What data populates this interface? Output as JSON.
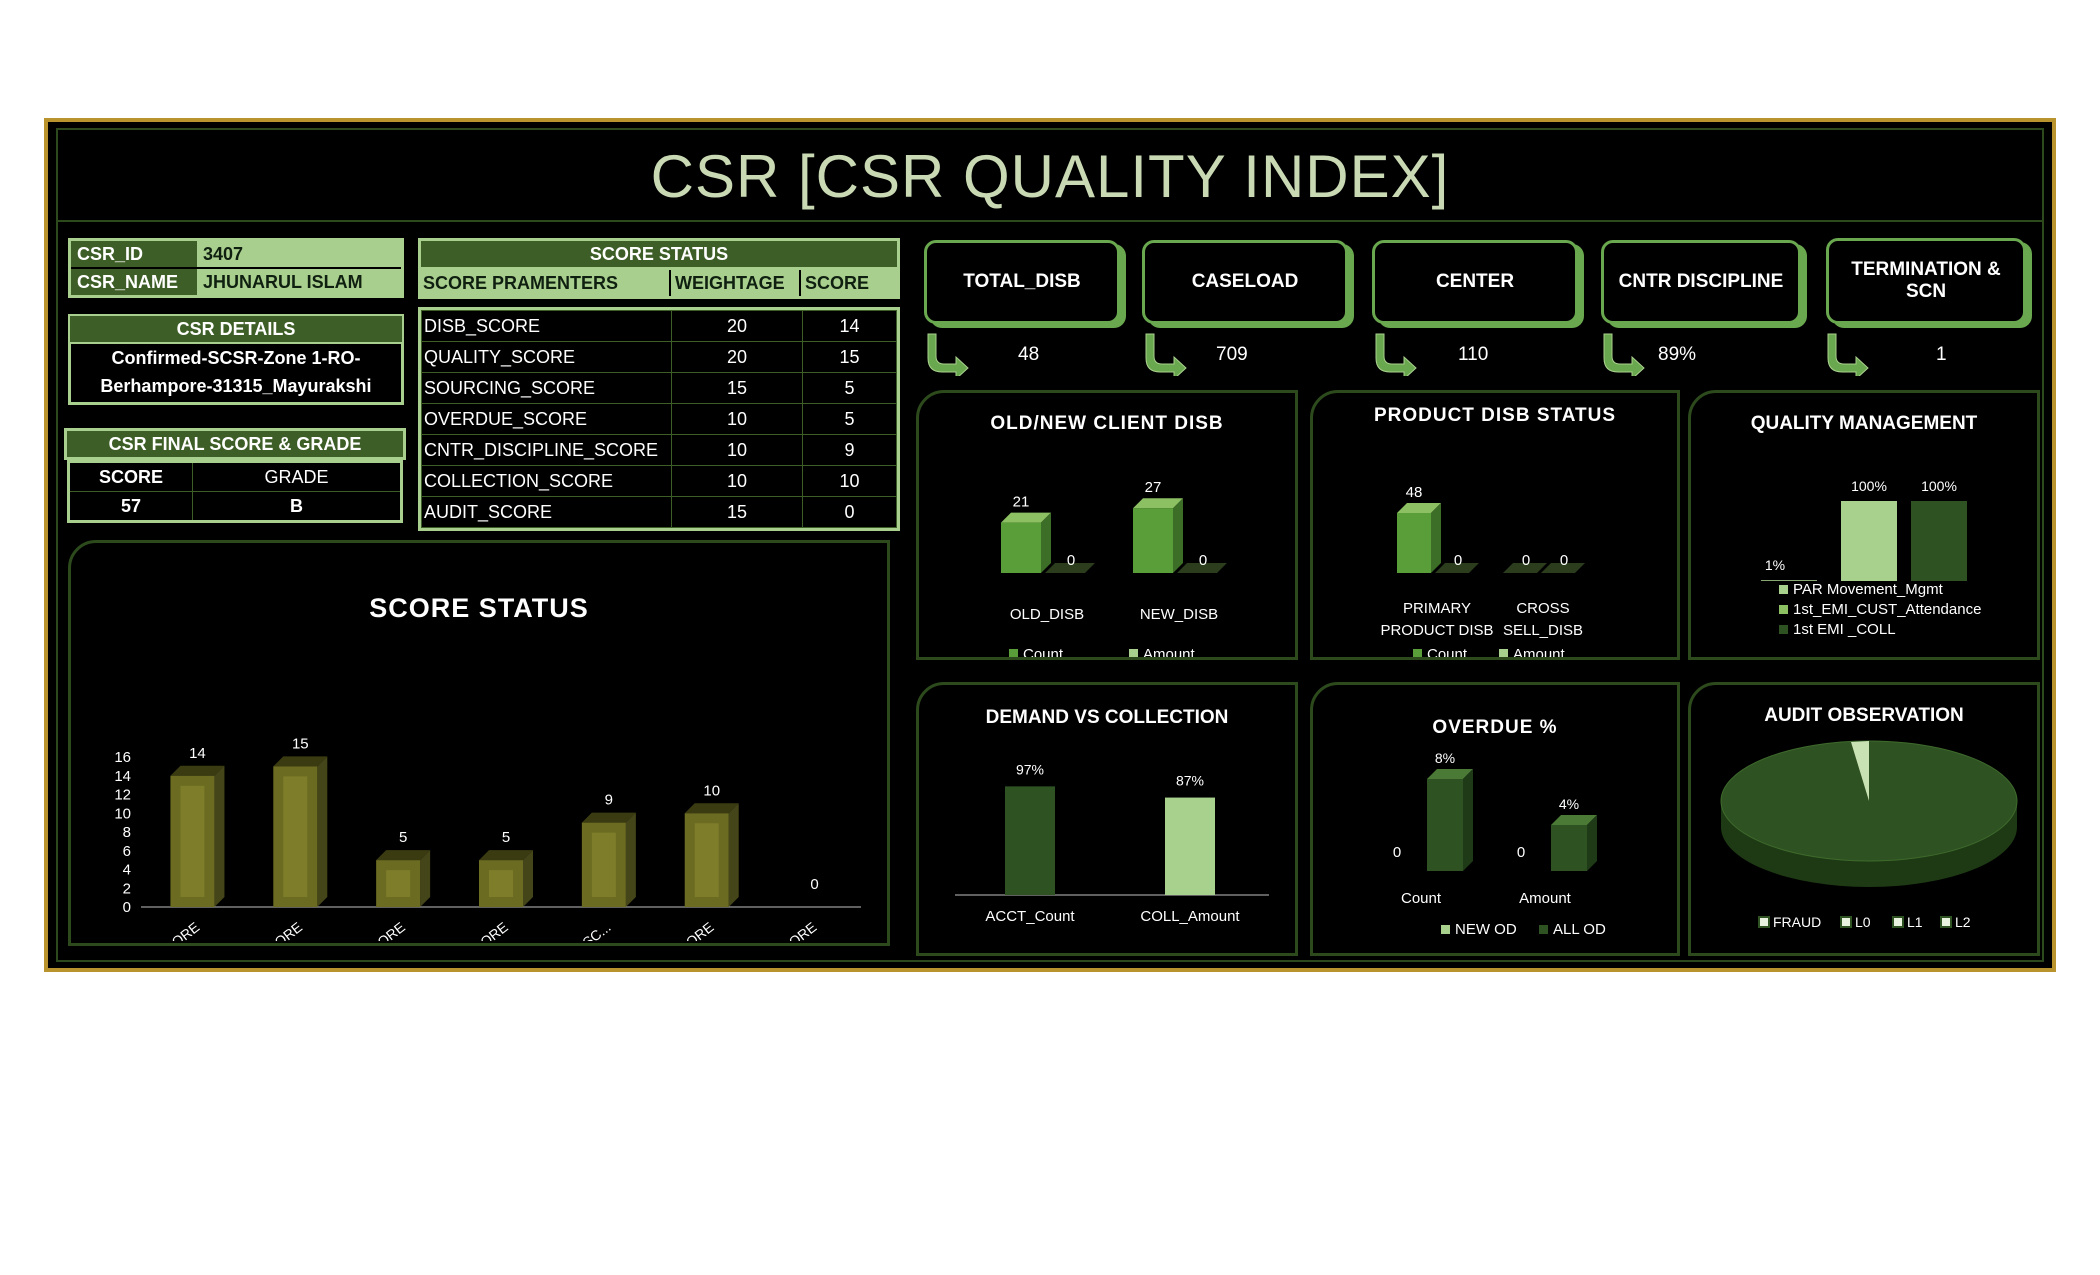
{
  "title": "CSR [CSR QUALITY INDEX]",
  "csr": {
    "id_label": "CSR_ID",
    "id_value": "3407",
    "name_label": "CSR_NAME",
    "name_value": "JHUNARUL ISLAM"
  },
  "details": {
    "header": "CSR DETAILS",
    "line1": "Confirmed-SCSR-Zone 1-RO-",
    "line2": "Berhampore-31315_Mayurakshi"
  },
  "final": {
    "header": "CSR FINAL SCORE & GRADE",
    "score_label": "SCORE",
    "grade_label": "GRADE",
    "score": "57",
    "grade": "B"
  },
  "score_status": {
    "header": "SCORE STATUS",
    "col1": "SCORE PRAMENTERS",
    "col2": "WEIGHTAGE",
    "col3": "SCORE",
    "rows": [
      {
        "name": "DISB_SCORE",
        "w": "20",
        "s": "14"
      },
      {
        "name": "QUALITY_SCORE",
        "w": "20",
        "s": "15"
      },
      {
        "name": "SOURCING_SCORE",
        "w": "15",
        "s": "5"
      },
      {
        "name": "OVERDUE_SCORE",
        "w": "10",
        "s": "5"
      },
      {
        "name": "CNTR_DISCIPLINE_SCORE",
        "w": "10",
        "s": "9"
      },
      {
        "name": "COLLECTION_SCORE",
        "w": "10",
        "s": "10"
      },
      {
        "name": "AUDIT_SCORE",
        "w": "15",
        "s": "0"
      }
    ]
  },
  "kpis": [
    {
      "label": "TOTAL_DISB",
      "value": "48"
    },
    {
      "label": "CASELOAD",
      "value": "709"
    },
    {
      "label": "CENTER",
      "value": "110"
    },
    {
      "label": "CNTR DISCIPLINE",
      "value": "89%"
    },
    {
      "label": "TERMINATION & SCN",
      "value": "1"
    }
  ],
  "colors": {
    "olive": "#6b6b22",
    "green": "#5a9e3a",
    "dark_green": "#2f5222",
    "light_green": "#a9d18e"
  },
  "chart_data": [
    {
      "type": "bar",
      "title": "SCORE STATUS",
      "categories": [
        "DISB_SCORE",
        "QUALITY_SCORE",
        "SOURCING_SCORE",
        "OVERDUE_SCORE",
        "CNTR_DISCIPLINE_SC...",
        "COLLECTION_SCORE",
        "AUDIT_SCORE"
      ],
      "values": [
        14,
        15,
        5,
        5,
        9,
        10,
        0
      ],
      "ylim": [
        0,
        16
      ],
      "yticks": [
        "0",
        "2",
        "4",
        "6",
        "8",
        "10",
        "12",
        "14",
        "16"
      ]
    },
    {
      "type": "bar",
      "title": "OLD/NEW CLIENT DISB",
      "categories": [
        "OLD_DISB",
        "NEW_DISB"
      ],
      "series": [
        {
          "name": "Count",
          "values": [
            21,
            27
          ]
        },
        {
          "name": "Amount",
          "values": [
            0,
            0
          ]
        }
      ]
    },
    {
      "type": "bar",
      "title": "PRODUCT DISB STATUS",
      "categories": [
        "PRIMARY PRODUCT DISB",
        "CROSS SELL_DISB"
      ],
      "series": [
        {
          "name": "Count",
          "values": [
            48,
            0
          ]
        },
        {
          "name": "Amount",
          "values": [
            0,
            0
          ]
        }
      ]
    },
    {
      "type": "bar",
      "title": "QUALITY MANAGEMENT",
      "series": [
        {
          "name": "PAR Movement_Mgmt",
          "values": [
            1
          ],
          "label": "1%"
        },
        {
          "name": "1st_EMI_CUST_Attendance",
          "values": [
            100
          ],
          "label": "100%"
        },
        {
          "name": "1st EMI _COLL",
          "values": [
            100
          ],
          "label": "100%"
        }
      ]
    },
    {
      "type": "bar",
      "title": "DEMAND VS COLLECTION",
      "categories": [
        "ACCT_Count",
        "COLL_Amount"
      ],
      "values": [
        97,
        87
      ],
      "labels": [
        "97%",
        "87%"
      ]
    },
    {
      "type": "bar",
      "title": "OVERDUE %",
      "categories": [
        "Count",
        "Amount"
      ],
      "series": [
        {
          "name": "NEW OD",
          "values": [
            0,
            0
          ]
        },
        {
          "name": "ALL OD",
          "values": [
            8,
            4
          ]
        }
      ],
      "labels": [
        "8%",
        "4%"
      ]
    },
    {
      "type": "pie",
      "title": "AUDIT OBSERVATION",
      "legend": [
        "FRAUD",
        "L0",
        "L1",
        "L2"
      ]
    }
  ]
}
